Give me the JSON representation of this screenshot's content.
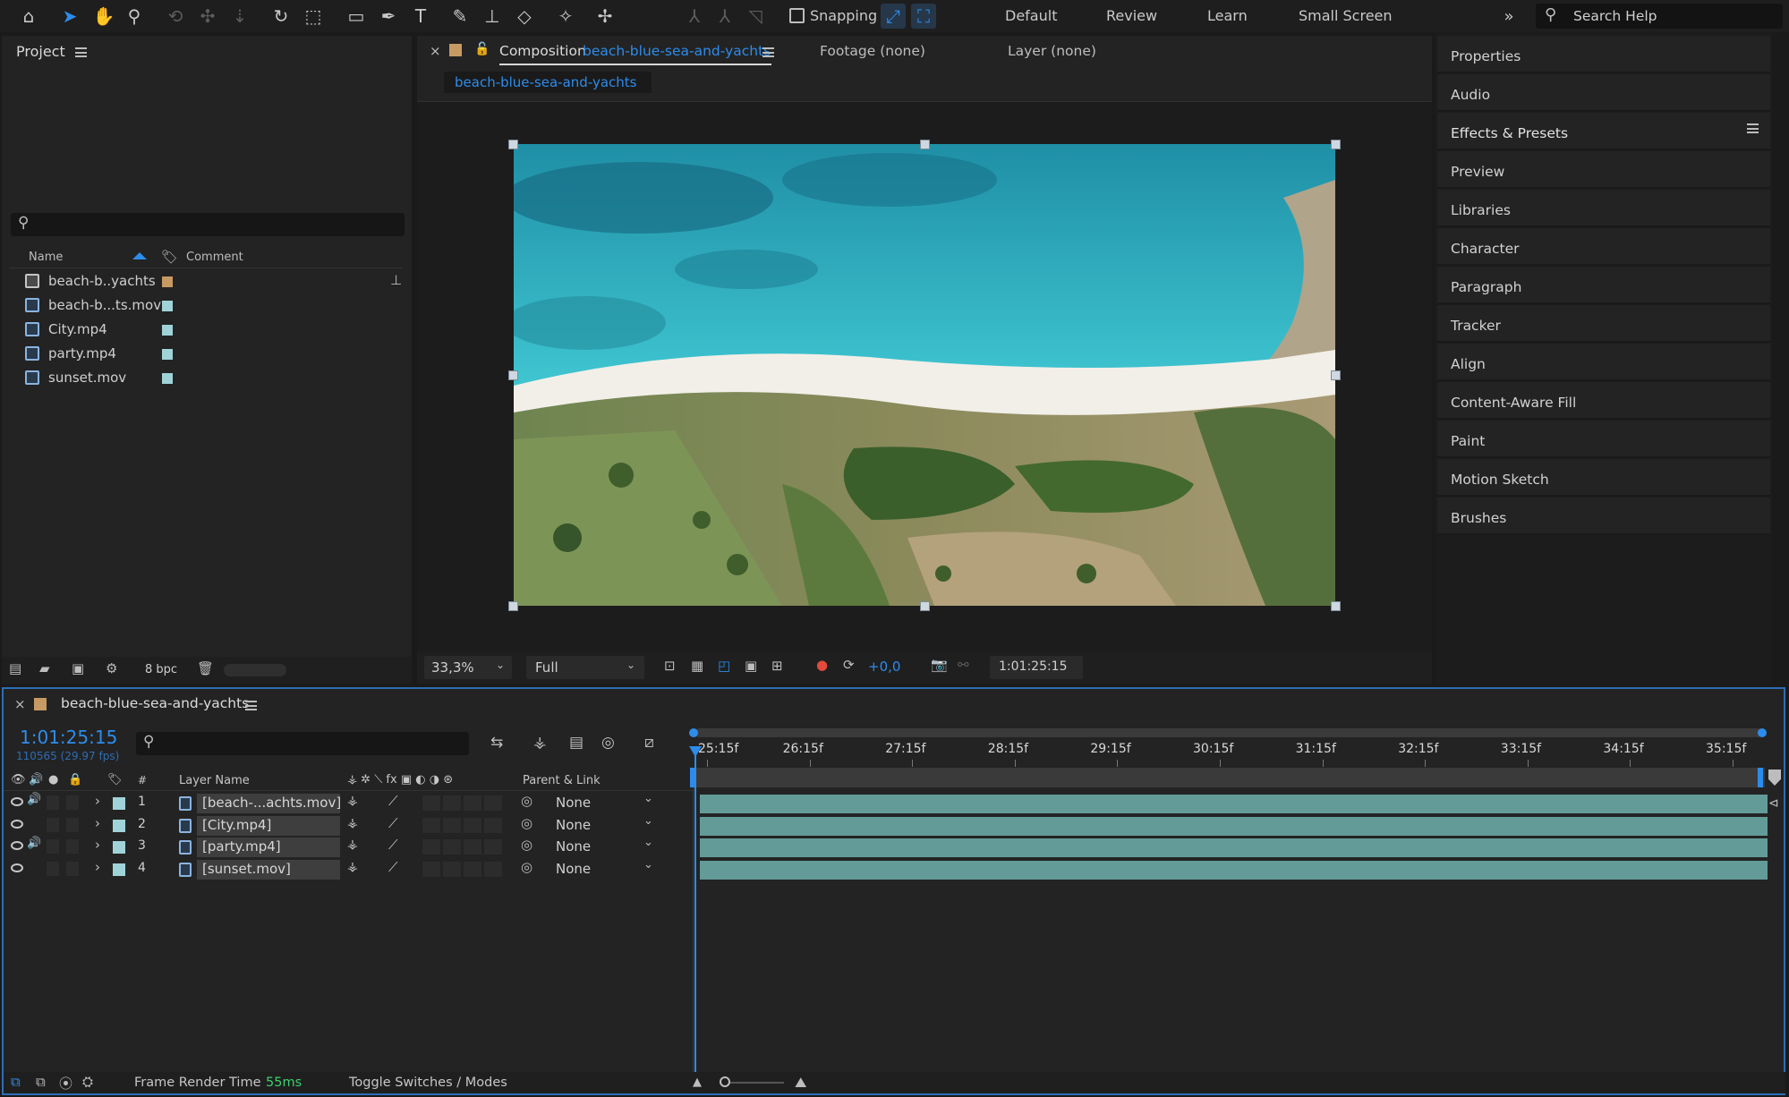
{
  "toolbar": {
    "snapping_label": "Snapping",
    "workspaces": [
      "Default",
      "Review",
      "Learn",
      "Small Screen"
    ],
    "search_placeholder": "Search Help"
  },
  "project_panel": {
    "title": "Project",
    "col_name": "Name",
    "col_comment": "Comment",
    "items": [
      {
        "name": "beach-b..yachts",
        "swatch": "#c79a63",
        "type": "composition"
      },
      {
        "name": "beach-b...ts.mov",
        "swatch": "#9fd3d8",
        "type": "footage"
      },
      {
        "name": "City.mp4",
        "swatch": "#9fd3d8",
        "type": "footage"
      },
      {
        "name": "party.mp4",
        "swatch": "#9fd3d8",
        "type": "footage"
      },
      {
        "name": "sunset.mov",
        "swatch": "#9fd3d8",
        "type": "footage"
      }
    ],
    "bpc": "8 bpc"
  },
  "viewer": {
    "composition_label": "Composition",
    "composition_name": "beach-blue-sea-and-yachts",
    "footage_tab": "Footage (none)",
    "layer_tab": "Layer (none)",
    "breadcrumb": "beach-blue-sea-and-yachts",
    "zoom": "33,3%",
    "resolution": "Full",
    "exposure": "+0,0",
    "timecode": "1:01:25:15"
  },
  "right_panel": {
    "items": [
      "Properties",
      "Audio",
      "Effects & Presets",
      "Preview",
      "Libraries",
      "Character",
      "Paragraph",
      "Tracker",
      "Align",
      "Content-Aware Fill",
      "Paint",
      "Motion Sketch",
      "Brushes"
    ]
  },
  "timeline": {
    "comp_name": "beach-blue-sea-and-yachts",
    "current_time": "1:01:25:15",
    "frame_info": "110565 (29.97 fps)",
    "col_hash": "#",
    "col_layer_name": "Layer Name",
    "col_parent": "Parent & Link",
    "time_labels": [
      "25:15f",
      "26:15f",
      "27:15f",
      "28:15f",
      "29:15f",
      "30:15f",
      "31:15f",
      "32:15f",
      "33:15f",
      "34:15f",
      "35:15f"
    ],
    "layers": [
      {
        "num": "1",
        "name": "[beach-...achts.mov]",
        "parent": "None",
        "audio": true
      },
      {
        "num": "2",
        "name": "[City.mp4]",
        "parent": "None",
        "audio": false
      },
      {
        "num": "3",
        "name": "[party.mp4]",
        "parent": "None",
        "audio": true
      },
      {
        "num": "4",
        "name": "[sunset.mov]",
        "parent": "None",
        "audio": false
      }
    ],
    "render_label": "Frame Render Time",
    "render_value": "55ms",
    "toggle_label": "Toggle Switches / Modes"
  },
  "colors": {
    "accent": "#2d8ceb",
    "clip": "#6aa8a5",
    "panel": "#232323"
  }
}
